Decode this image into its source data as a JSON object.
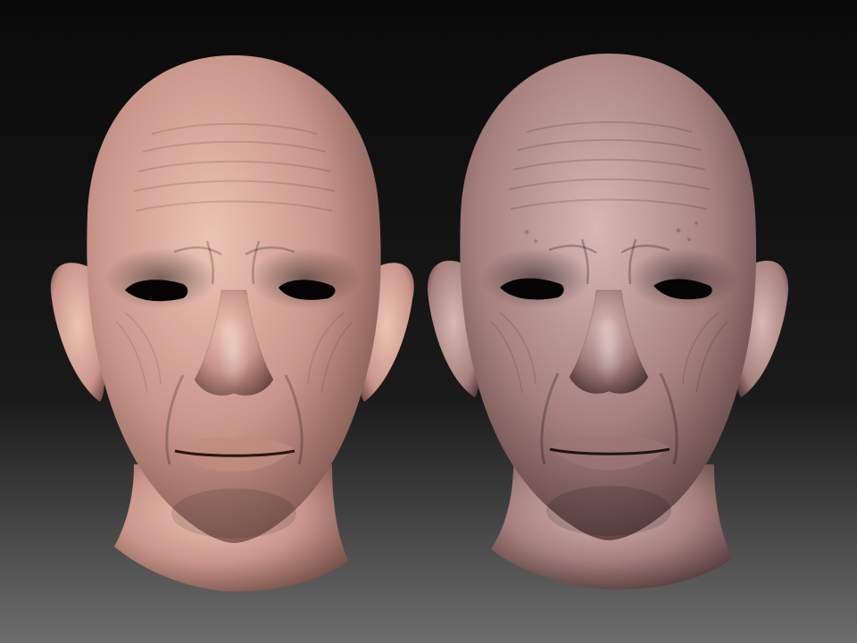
{
  "scene": {
    "colors": {
      "bg_top": "#0a0a0a",
      "bg_mid": "#1a1a1a",
      "bg_bottom": "#6e6e6e",
      "left_skin_light": "#ecc4b4",
      "left_skin_mid": "#c9958a",
      "left_skin_dark": "#6e4a44",
      "right_skin_light": "#d7b8b4",
      "right_skin_mid": "#a8817f",
      "right_skin_dark": "#4c3534",
      "eye_void": "#050303"
    },
    "subjects": [
      {
        "id": "left-head",
        "material": "pinkish-skin-matcap"
      },
      {
        "id": "right-head",
        "material": "mauve-clay-matcap"
      }
    ]
  }
}
